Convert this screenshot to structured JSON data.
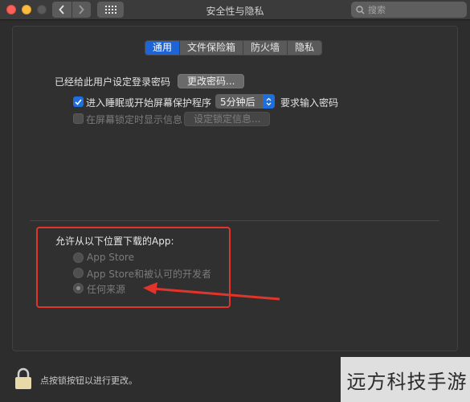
{
  "window": {
    "title": "安全性与隐私"
  },
  "search": {
    "placeholder": "搜索"
  },
  "tabs": [
    {
      "label": "通用",
      "active": true
    },
    {
      "label": "文件保险箱",
      "active": false
    },
    {
      "label": "防火墙",
      "active": false
    },
    {
      "label": "隐私",
      "active": false
    }
  ],
  "general": {
    "password_label": "已经给此用户设定登录密码",
    "change_password_button": "更改密码...",
    "require_password_checkbox": {
      "checked": true,
      "label_before": "进入睡眠或开始屏幕保护程序",
      "label_after": "要求输入密码"
    },
    "delay_select": {
      "value": "5分钟后"
    },
    "lock_message_checkbox": {
      "checked": false,
      "label": "在屏幕锁定时显示信息",
      "enabled": false
    },
    "set_lock_message_button": "设定锁定信息..."
  },
  "downloads": {
    "title": "允许从以下位置下载的App:",
    "options": [
      {
        "label": "App Store",
        "selected": false
      },
      {
        "label": "App Store和被认可的开发者",
        "selected": false
      },
      {
        "label": "任何来源",
        "selected": true
      }
    ]
  },
  "footer": {
    "lock_text": "点按锁按钮以进行更改。"
  },
  "watermark": {
    "text": "远方科技手游"
  },
  "colors": {
    "accent": "#1d64d6",
    "annotation": "#e2342a"
  }
}
